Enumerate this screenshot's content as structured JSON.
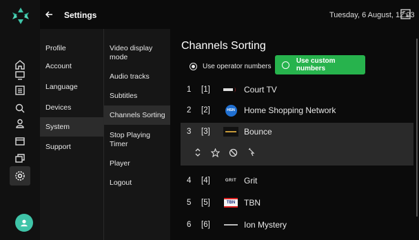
{
  "header": {
    "title": "Settings",
    "datetime": "Tuesday, 6 August, 12:03"
  },
  "rail": {
    "icons": [
      "home-icon",
      "tv-icon",
      "guide-icon",
      "search-icon",
      "user-icon",
      "recordings-icon",
      "library-icon",
      "settings-icon"
    ],
    "active": "settings-icon",
    "accent": "#3fc4a8"
  },
  "menu": {
    "items": [
      "Profile",
      "Account",
      "Language",
      "Devices",
      "System",
      "Support"
    ],
    "selected": "System"
  },
  "submenu": {
    "items": [
      "Video display mode",
      "Audio tracks",
      "Subtitles",
      "Channels Sorting",
      "Stop Playing Timer",
      "Player",
      "Logout"
    ],
    "selected": "Channels Sorting"
  },
  "main": {
    "title": "Channels Sorting",
    "operator_label": "Use operator numbers",
    "custom_label": "Use custom numbers",
    "accent": "#27b34d"
  },
  "channels": [
    {
      "num": "1",
      "bracket": "[1]",
      "name": "Court TV",
      "logo": "court-tv-logo"
    },
    {
      "num": "2",
      "bracket": "[2]",
      "name": "Home Shopping Network",
      "logo": "hsn-logo",
      "logo_text": "HSN"
    },
    {
      "num": "3",
      "bracket": "[3]",
      "name": "Bounce",
      "logo": "bounce-logo"
    },
    {
      "num": "4",
      "bracket": "[4]",
      "name": "Grit",
      "logo": "grit-logo",
      "logo_text": "GRIT"
    },
    {
      "num": "5",
      "bracket": "[5]",
      "name": "TBN",
      "logo": "tbn-logo",
      "logo_text": "TBN"
    },
    {
      "num": "6",
      "bracket": "[6]",
      "name": "Ion Mystery",
      "logo": "ion-mystery-logo"
    }
  ],
  "row_actions": [
    "reorder-icon",
    "favorite-icon",
    "block-icon",
    "drag-icon"
  ]
}
